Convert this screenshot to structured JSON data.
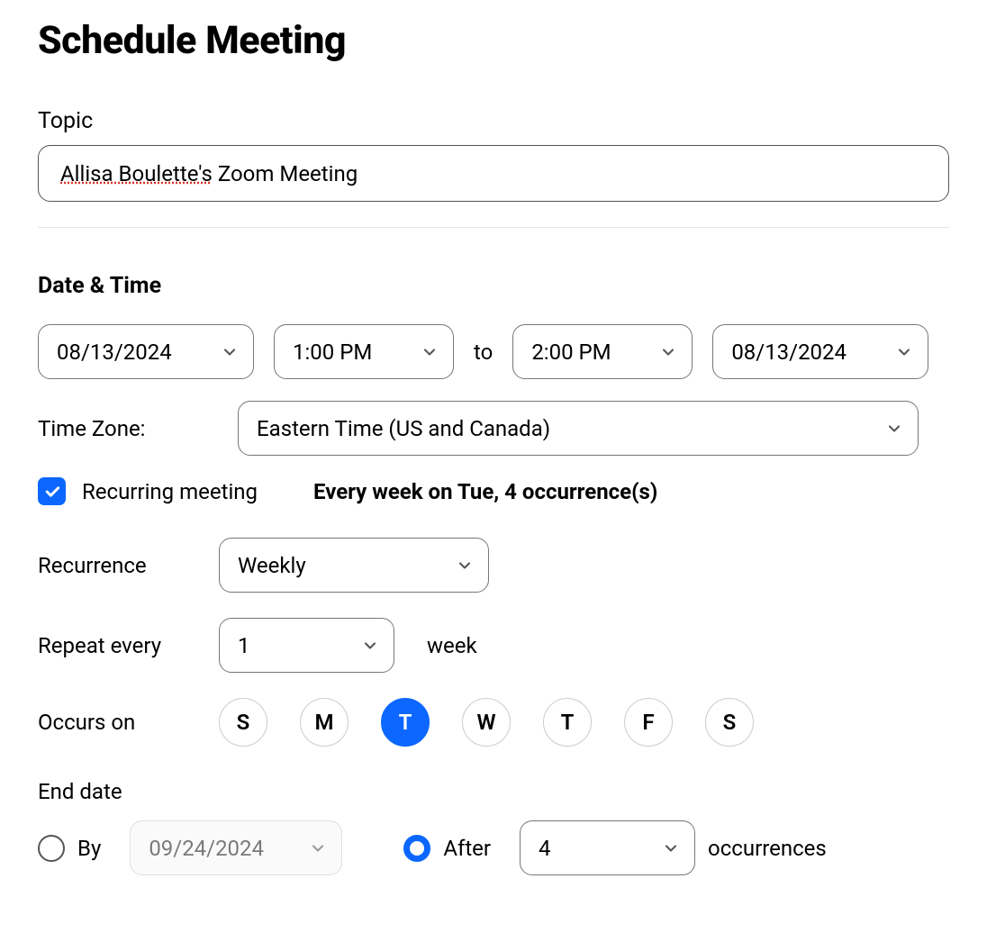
{
  "page_title": "Schedule Meeting",
  "topic": {
    "label": "Topic",
    "value_spellerr": "Allisa Boulette's",
    "value_rest": " Zoom Meeting"
  },
  "datetime": {
    "heading": "Date & Time",
    "start_date": "08/13/2024",
    "start_time": "1:00 PM",
    "to_label": "to",
    "end_time": "2:00 PM",
    "end_date": "08/13/2024",
    "timezone_label": "Time Zone:",
    "timezone_value": "Eastern Time (US and Canada)"
  },
  "recurring": {
    "checkbox_label": "Recurring meeting",
    "summary": "Every week on Tue, 4 occurrence(s)"
  },
  "recurrence": {
    "label": "Recurrence",
    "value": "Weekly"
  },
  "repeat": {
    "label": "Repeat every",
    "value": "1",
    "unit": "week"
  },
  "occurs": {
    "label": "Occurs on",
    "days": [
      "S",
      "M",
      "T",
      "W",
      "T",
      "F",
      "S"
    ],
    "selected_index": 2
  },
  "end": {
    "label": "End date",
    "by_label": "By",
    "by_date": "09/24/2024",
    "after_label": "After",
    "after_value": "4",
    "after_unit": "occurrences",
    "selected": "after"
  }
}
